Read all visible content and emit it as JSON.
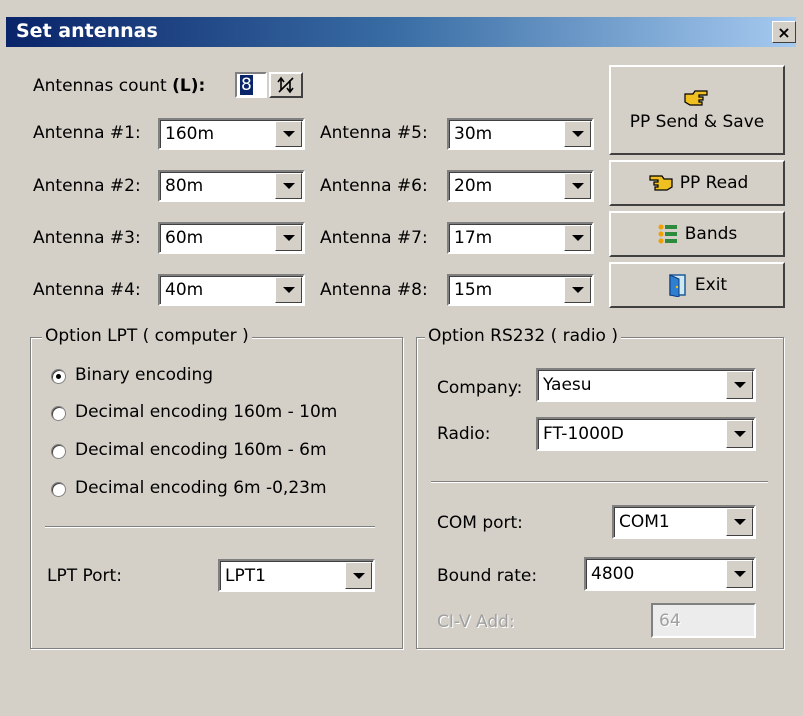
{
  "window": {
    "title": "Set antennas",
    "close_glyph": "×"
  },
  "antennas_count": {
    "label_prefix": "Antennas count ",
    "label_bold": "(L):",
    "value": "8"
  },
  "antennas": [
    {
      "label": "Antenna #1:",
      "value": "160m"
    },
    {
      "label": "Antenna #2:",
      "value": "80m"
    },
    {
      "label": "Antenna #3:",
      "value": "60m"
    },
    {
      "label": "Antenna #4:",
      "value": "40m"
    },
    {
      "label": "Antenna #5:",
      "value": "30m"
    },
    {
      "label": "Antenna #6:",
      "value": "20m"
    },
    {
      "label": "Antenna #7:",
      "value": "17m"
    },
    {
      "label": "Antenna #8:",
      "value": "15m"
    }
  ],
  "buttons": {
    "send_save": "PP Send & Save",
    "read": "PP Read",
    "bands": "Bands",
    "exit": "Exit"
  },
  "lpt": {
    "title": "Option LPT ( computer )",
    "options": [
      "Binary encoding",
      "Decimal encoding 160m - 10m",
      "Decimal encoding 160m - 6m",
      "Decimal encoding 6m -0,23m"
    ],
    "selected_index": 0,
    "port_label": "LPT Port:",
    "port_value": "LPT1"
  },
  "rs232": {
    "title": "Option RS232 ( radio )",
    "company_label": "Company:",
    "company_value": "Yaesu",
    "radio_label": "Radio:",
    "radio_value": "FT-1000D",
    "com_label": "COM port:",
    "com_value": "COM1",
    "baud_label": "Bound rate:",
    "baud_value": "4800",
    "civ_label": "CI-V Add:",
    "civ_value": "64"
  },
  "colors": {
    "titlebar_start": "#0a246a",
    "titlebar_end": "#a6caf0",
    "face": "#d4d0c8"
  }
}
